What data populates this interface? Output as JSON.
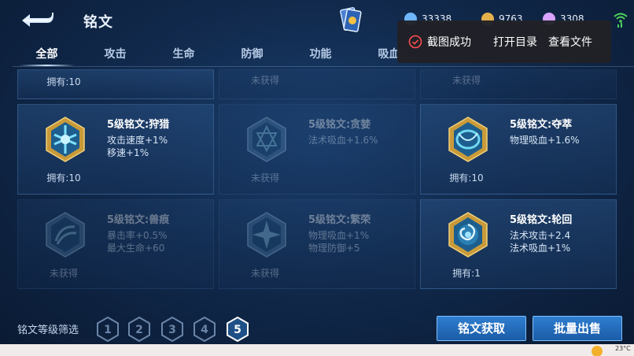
{
  "header": {
    "title": "铭文",
    "currencies": [
      {
        "icon": "blue-gem-icon",
        "value": "33338",
        "color": "#6fb6ff"
      },
      {
        "icon": "gold-coin-icon",
        "value": "9763",
        "color": "#e3b04b"
      },
      {
        "icon": "purple-crystal-icon",
        "value": "3308",
        "color": "#d7a3ff"
      }
    ]
  },
  "tabs": [
    {
      "label": "全部",
      "active": true
    },
    {
      "label": "攻击",
      "active": false
    },
    {
      "label": "生命",
      "active": false
    },
    {
      "label": "防御",
      "active": false
    },
    {
      "label": "功能",
      "active": false
    },
    {
      "label": "吸血",
      "active": false
    }
  ],
  "toast": {
    "message": "截图成功",
    "open_dir": "打开目录",
    "view_file": "查看文件"
  },
  "grid": {
    "partial_row": [
      {
        "count": "拥有:10",
        "owned": true
      },
      {
        "count": "未获得",
        "owned": false
      },
      {
        "count": "未获得",
        "owned": false
      }
    ],
    "rows": [
      [
        {
          "name": "5级铭文:狩猎",
          "attrs": [
            "攻击速度+1%",
            "移速+1%"
          ],
          "count": "拥有:10",
          "owned": true,
          "color": "#7fe0ff"
        },
        {
          "name": "5级铭文:贪婪",
          "attrs": [
            "法术吸血+1.6%"
          ],
          "count": "未获得",
          "owned": false,
          "color": "#8fd0e8"
        },
        {
          "name": "5级铭文:夺萃",
          "attrs": [
            "物理吸血+1.6%"
          ],
          "count": "拥有:10",
          "owned": true,
          "color": "#6fd6f2"
        }
      ],
      [
        {
          "name": "5级铭文:兽痕",
          "attrs": [
            "暴击率+0.5%",
            "最大生命+60"
          ],
          "count": "未获得",
          "owned": false,
          "color": "#8ec6e4"
        },
        {
          "name": "5级铭文:繁荣",
          "attrs": [
            "物理吸血+1%",
            "物理防御+5"
          ],
          "count": "未获得",
          "owned": false,
          "color": "#8ec6e4"
        },
        {
          "name": "5级铭文:轮回",
          "attrs": [
            "法术攻击+2.4",
            "法术吸血+1%"
          ],
          "count": "拥有:1",
          "owned": true,
          "color": "#9ee2ff"
        }
      ]
    ]
  },
  "bottom": {
    "filter_label": "铭文等级筛选",
    "levels": [
      "1",
      "2",
      "3",
      "4",
      "5"
    ],
    "selected_level": "5",
    "get_button": "铭文获取",
    "sell_button": "批量出售"
  },
  "system": {
    "temperature": "23°C"
  }
}
